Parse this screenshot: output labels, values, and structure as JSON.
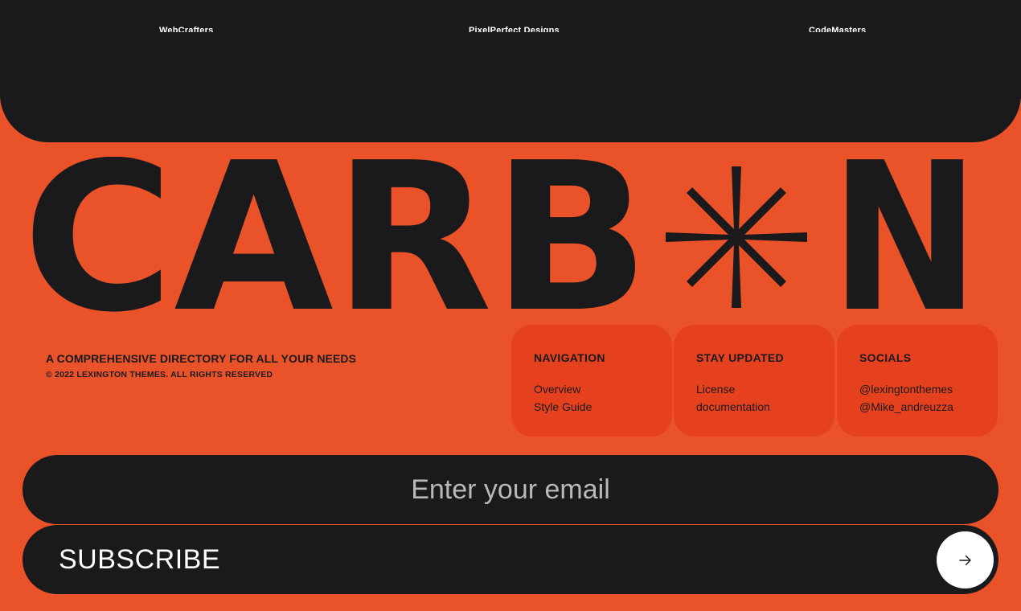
{
  "partners": [
    "WebCrafters",
    "PixelPerfect Designs",
    "CodeMasters"
  ],
  "logo": {
    "text": "CARB*N",
    "letters_left": "CARB",
    "letters_right": "N"
  },
  "footer": {
    "tagline": "A COMPREHENSIVE DIRECTORY FOR ALL YOUR NEEDS",
    "copyright": "© 2022 LEXINGTON THEMES. ALL RIGHTS RESERVED"
  },
  "cards": {
    "navigation": {
      "title": "NAVIGATION",
      "links": [
        "Overview",
        "Style Guide"
      ]
    },
    "updates": {
      "title": "STAY UPDATED",
      "links": [
        "License",
        "documentation"
      ]
    },
    "socials": {
      "title": "SOCIALS",
      "links": [
        "@lexingtonthemes",
        "@Mike_andreuzza"
      ]
    }
  },
  "newsletter": {
    "email_placeholder": "Enter your email",
    "email_value": "",
    "subscribe_label": "SUBSCRIBE",
    "arrow_icon": "arrow-right-icon"
  },
  "colors": {
    "accent": "#ea532a",
    "card": "#e6411f",
    "dark": "#1a1a1c",
    "white": "#ffffff"
  }
}
